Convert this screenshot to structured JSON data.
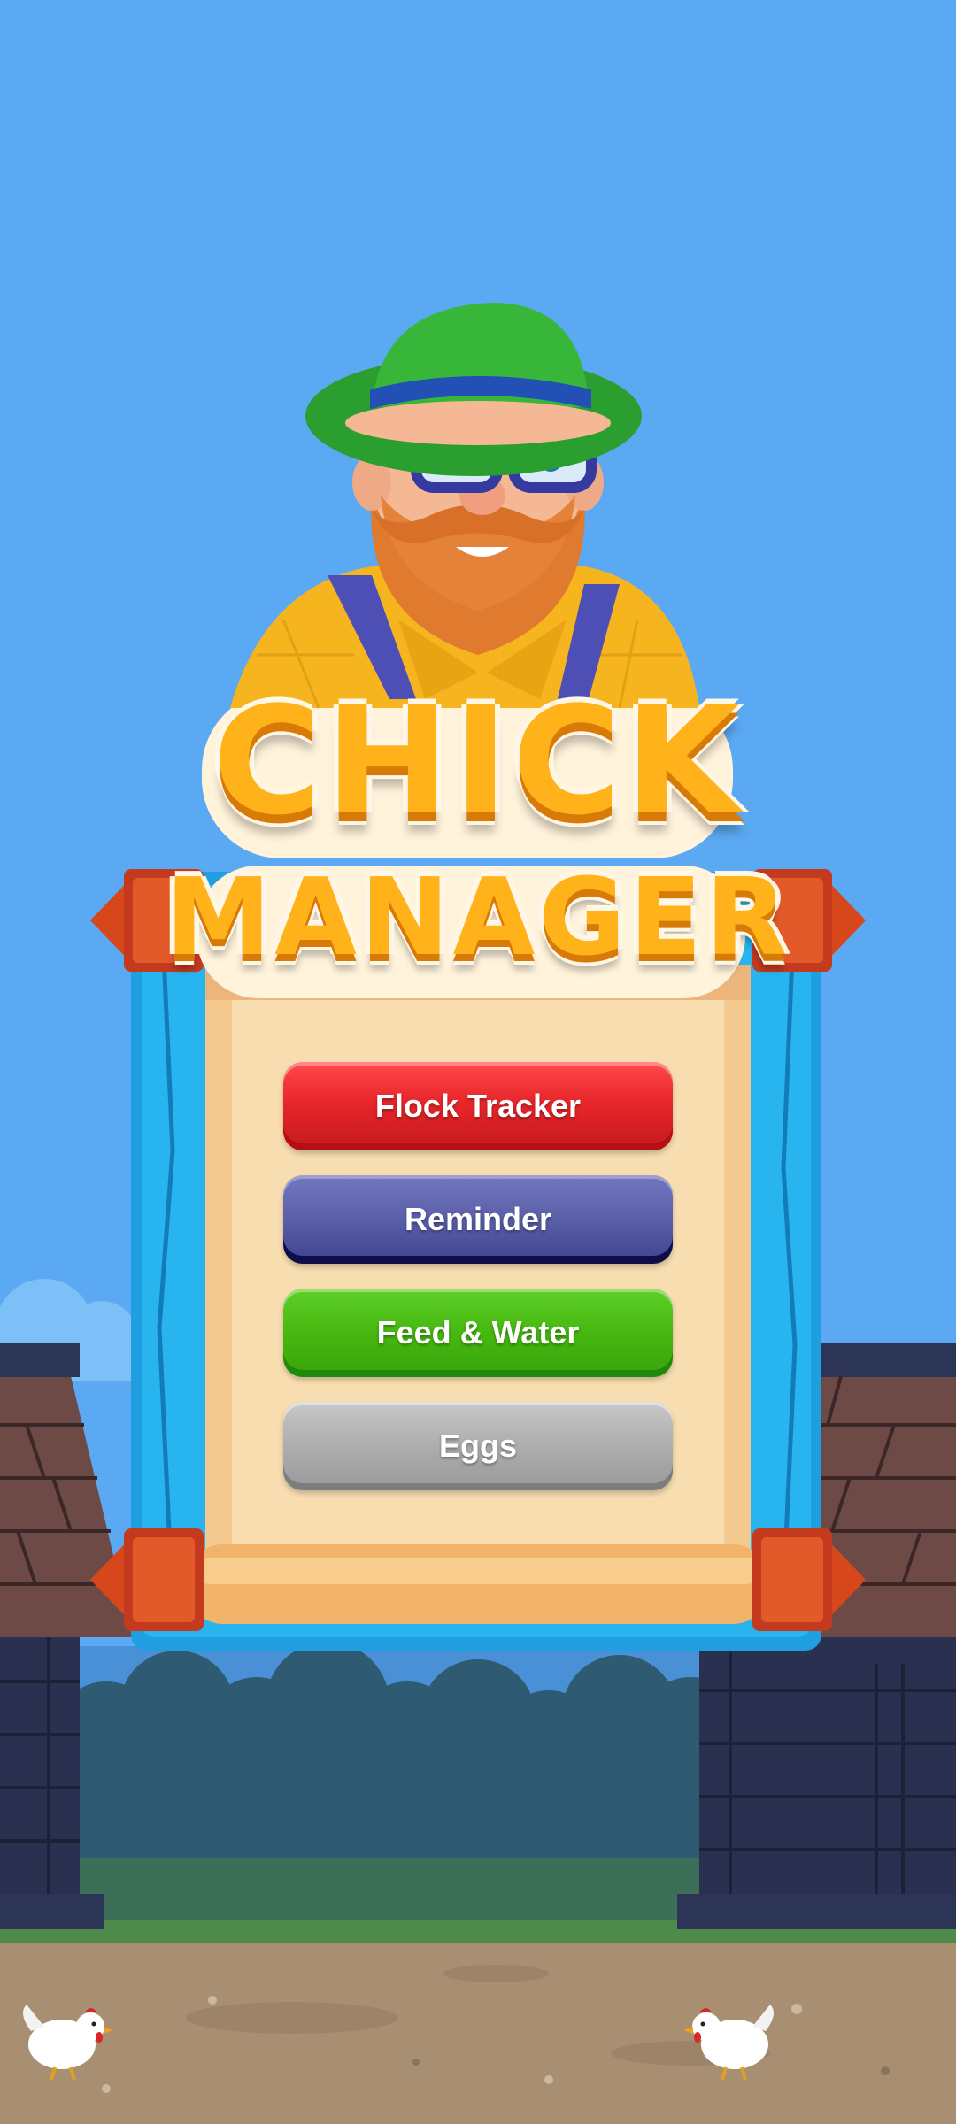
{
  "app": {
    "title_line_1": "CHICK",
    "title_line_2": "MANAGER"
  },
  "menu": {
    "buttons": [
      {
        "label": "Flock Tracker",
        "color": "#e8262b"
      },
      {
        "label": "Reminder",
        "color": "#5a5fa8"
      },
      {
        "label": "Feed & Water",
        "color": "#47b80f"
      },
      {
        "label": "Eggs",
        "color": "#adadad"
      }
    ]
  },
  "scene": {
    "sky_color": "#5ba9f2",
    "character": "farmer-mascot",
    "decor": [
      "barn-left",
      "barn-right",
      "bushes",
      "chicken-left",
      "chicken-right",
      "scroll-banner"
    ]
  }
}
